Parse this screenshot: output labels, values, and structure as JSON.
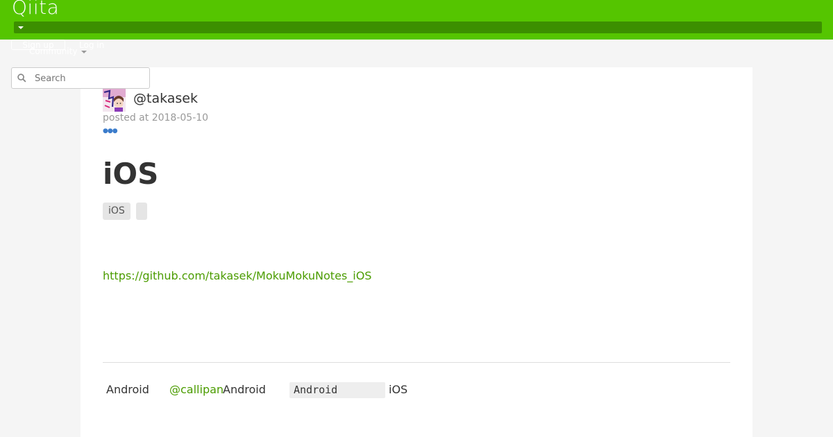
{
  "header": {
    "logo": "Qiita",
    "signup_label": "Sign up",
    "login_label": "Log in",
    "community_label": "Community"
  },
  "search": {
    "placeholder": "Search"
  },
  "article": {
    "author": "@takasek",
    "posted": "posted at 2018-05-10",
    "title": "iOS",
    "tags": [
      "iOS",
      ""
    ],
    "link": "https://github.com/takasek/MokuMokuNotes_iOS"
  },
  "footer": {
    "word1": "Android",
    "mention": "@callipan",
    "word2": "Android",
    "code": "Android",
    "word3": "iOS"
  },
  "colors": {
    "brand": "#55c500",
    "brand_dark": "#3c8f00",
    "link": "#4b9c00"
  }
}
